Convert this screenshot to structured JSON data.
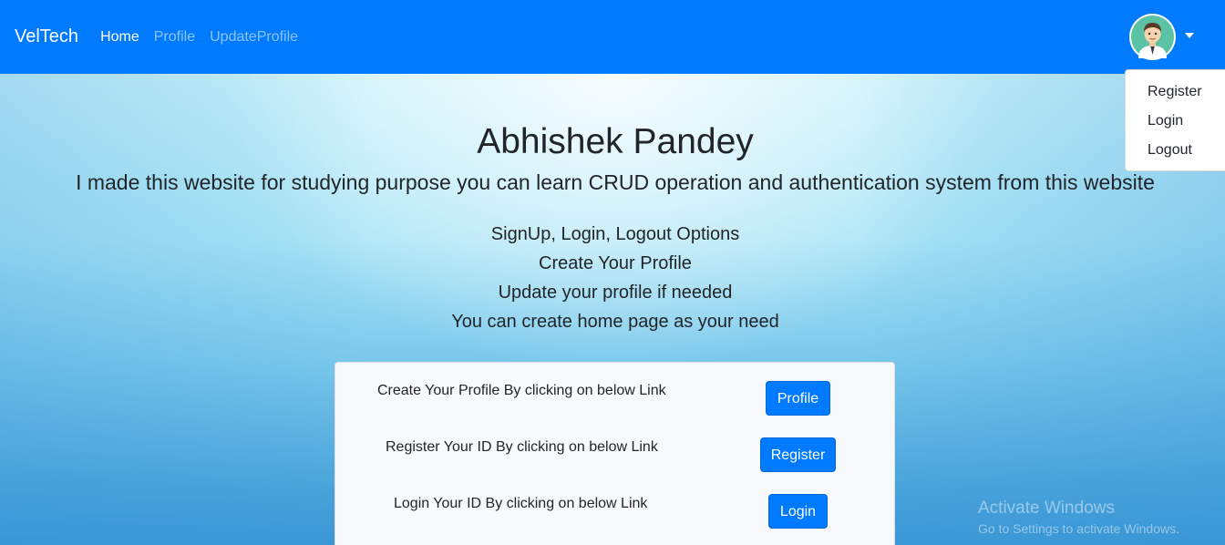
{
  "navbar": {
    "brand": "VelTech",
    "links": [
      {
        "label": "Home"
      },
      {
        "label": "Profile"
      },
      {
        "label": "UpdateProfile"
      }
    ]
  },
  "user_menu": {
    "items": [
      {
        "label": "Register"
      },
      {
        "label": "Login"
      },
      {
        "label": "Logout"
      }
    ]
  },
  "hero": {
    "title": "Abhishek Pandey",
    "subtitle": "I made this website for studying purpose you can learn CRUD operation and authentication system from this website",
    "features": [
      "SignUp, Login, Logout Options",
      "Create Your Profile",
      "Update your profile if needed",
      "You can create home page as your need"
    ]
  },
  "card": {
    "rows": [
      {
        "text": "Create Your Profile By clicking on below Link",
        "button": "Profile"
      },
      {
        "text": "Register Your ID By clicking on below Link",
        "button": "Register"
      },
      {
        "text": "Login Your ID By clicking on below Link",
        "button": "Login"
      }
    ]
  },
  "watermark": {
    "title": "Activate Windows",
    "subtitle": "Go to Settings to activate Windows."
  },
  "colors": {
    "primary": "#007bff",
    "card_bg": "#f8f9fa"
  }
}
